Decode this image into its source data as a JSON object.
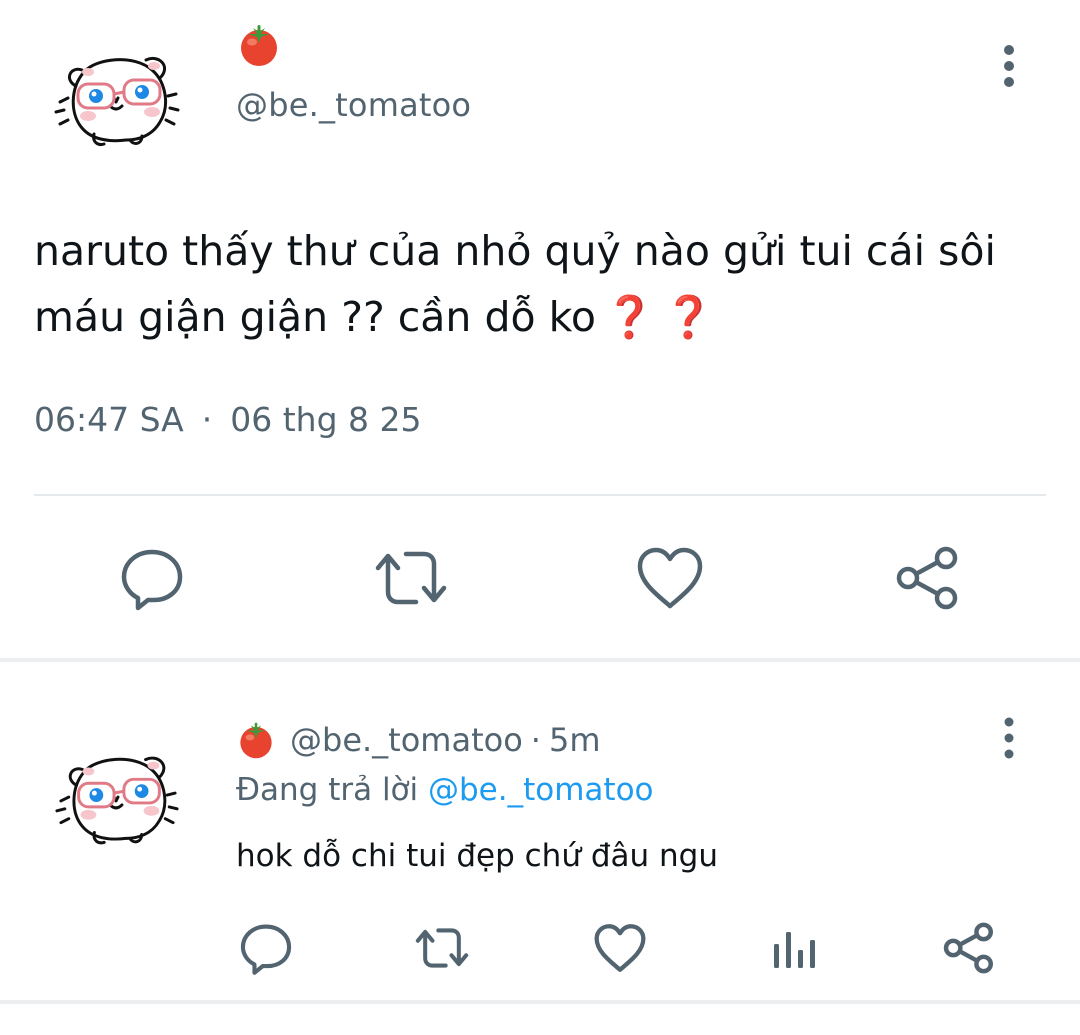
{
  "main_tweet": {
    "name_emoji": "tomato",
    "handle": "@be._tomatoo",
    "text": "naruto thấy thư của nhỏ quỷ nào gửi tui cái sôi máu giận giận ?? cần dỗ ko",
    "emoji_suffix": [
      "❓",
      "❓"
    ],
    "time": "06:47 SA",
    "date": "06 thg 8 25",
    "separator": "·",
    "icons": {
      "more": "more-vertical-icon",
      "reply": "reply-bubble-icon",
      "retweet": "retweet-icon",
      "like": "heart-icon",
      "share": "share-icon"
    }
  },
  "reply": {
    "name_emoji": "tomato",
    "handle": "@be._tomatoo",
    "separator": "·",
    "time_ago": "5m",
    "replying_label": "Đang trả lời",
    "replying_to": "@be._tomatoo",
    "text": "hok dỗ chi tui đẹp chứ đâu ngu",
    "icons": {
      "more": "more-vertical-icon",
      "reply": "reply-bubble-icon",
      "retweet": "retweet-icon",
      "like": "heart-icon",
      "stats": "bar-chart-icon",
      "share": "share-icon"
    }
  },
  "colors": {
    "text": "#0f1419",
    "muted": "#536471",
    "link": "#1d9bf0",
    "question_mark": "#dd2e2e",
    "icon": "#536471",
    "divider": "#e6e9ec"
  }
}
